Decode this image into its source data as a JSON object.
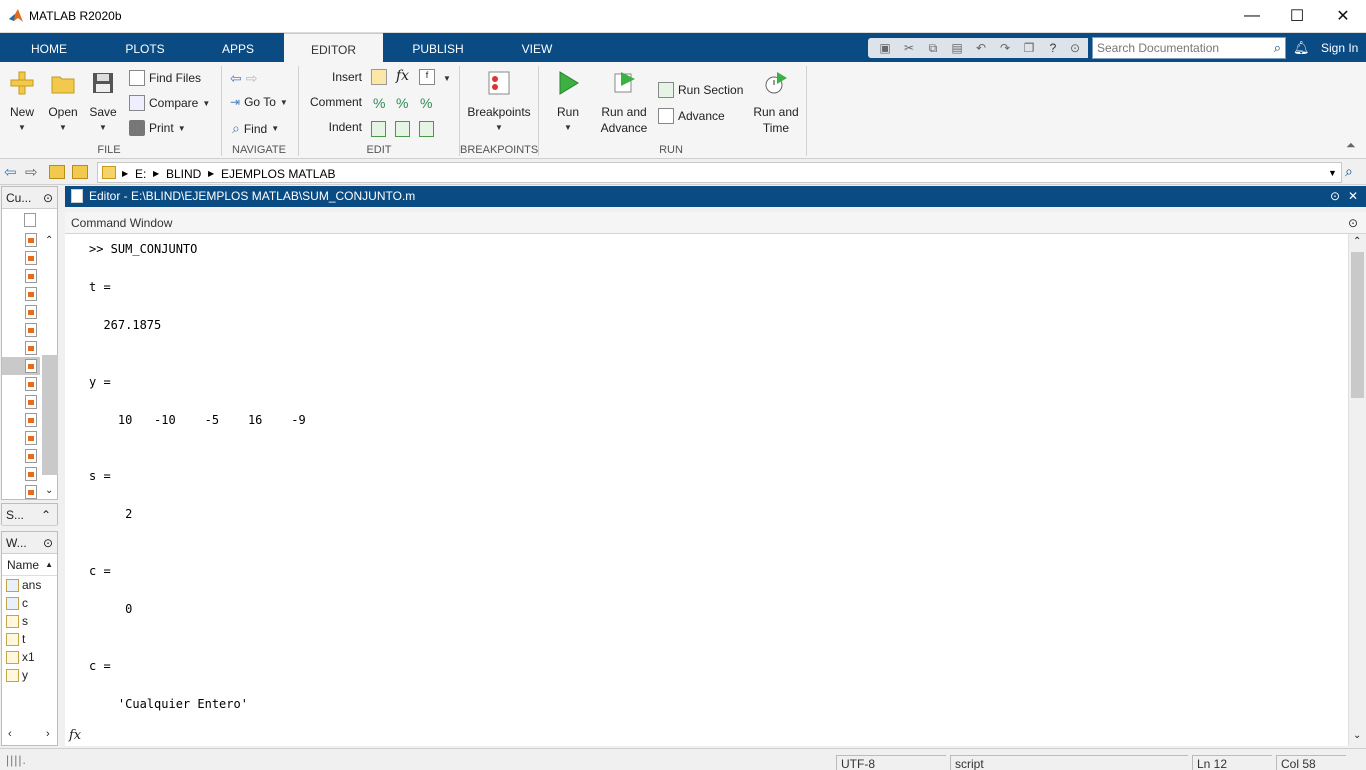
{
  "window": {
    "title": "MATLAB R2020b",
    "min_glyph": "—",
    "max_glyph": "☐",
    "close_glyph": "✕"
  },
  "tabs": [
    {
      "label": "HOME"
    },
    {
      "label": "PLOTS"
    },
    {
      "label": "APPS"
    },
    {
      "label": "EDITOR"
    },
    {
      "label": "PUBLISH"
    },
    {
      "label": "VIEW"
    }
  ],
  "search": {
    "placeholder": "Search Documentation"
  },
  "signin": "Sign In",
  "ribbon": {
    "file": {
      "group": "FILE",
      "new": "New",
      "open": "Open",
      "save": "Save",
      "find_files": "Find Files",
      "compare": "Compare",
      "print": "Print"
    },
    "navigate": {
      "group": "NAVIGATE",
      "go_to": "Go To",
      "find": "Find"
    },
    "edit": {
      "group": "EDIT",
      "insert": "Insert",
      "comment": "Comment",
      "indent": "Indent"
    },
    "breakpoints": {
      "group": "BREAKPOINTS",
      "breakpoints": "Breakpoints"
    },
    "run": {
      "group": "RUN",
      "run": "Run",
      "run_and": "Run and",
      "advance_word": "Advance",
      "run_section": "Run Section",
      "advance": "Advance",
      "run_and2": "Run and",
      "time": "Time"
    }
  },
  "address": {
    "parts": [
      "E:",
      "BLIND",
      "EJEMPLOS MATLAB"
    ]
  },
  "left": {
    "current_folder_short": "Cu...",
    "details_short": "S...",
    "workspace_short": "W...",
    "name_col": "Name",
    "vars": [
      "ans",
      "c",
      "s",
      "t",
      "x1",
      "y"
    ]
  },
  "editor": {
    "title": "Editor - E:\\BLIND\\EJEMPLOS MATLAB\\SUM_CONJUNTO.m"
  },
  "command_window": {
    "title": "Command Window",
    "lines": [
      ">> SUM_CONJUNTO",
      "t =",
      "  267.1875",
      "y =",
      "    10   -10    -5    16    -9",
      "s =",
      "     2",
      "c =",
      "     0",
      "c =",
      "    'Cualquier Entero'"
    ],
    "prompt_glyph": "fx"
  },
  "status": {
    "encoding": "UTF-8",
    "type": "script",
    "ln": "Ln  12",
    "col": "Col  58"
  },
  "colors": {
    "tabbar": "#0a4b84",
    "ribbon": "#f5f5f5",
    "accent_orange": "#e36c1f"
  }
}
